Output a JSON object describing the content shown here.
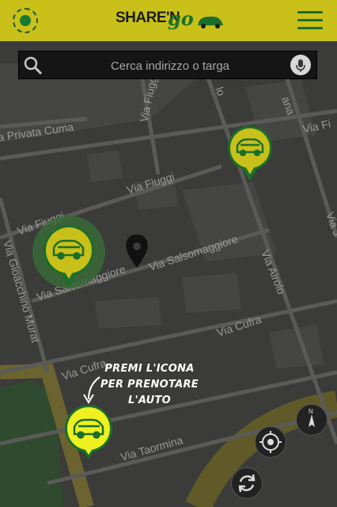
{
  "header": {
    "logo_prefix": "SHARE'N",
    "logo_suffix": "go",
    "status_icon": "status-indicator-icon",
    "menu_icon": "hamburger-menu-icon"
  },
  "search": {
    "placeholder": "Cerca indirizzo o targa",
    "search_icon": "magnifier-icon",
    "mic_icon": "microphone-icon"
  },
  "streets": {
    "privata_cuma": "a Privata Cuma",
    "fiuggi_1": "Via Fiuggi",
    "fiuggi_2": "Via Fiuggi",
    "fiuggi_vert": "Via Fiuggi",
    "salsomaggiore_1": "Via Salsomaggiore",
    "salsomaggiore_2": "Via Salsomaggiore",
    "gioacchino_murat": "Via Gioacchino Murat",
    "airolo": "Via Airolo",
    "cufra_1": "Via Cufra",
    "cufra_2": "Via Cufra",
    "taormina": "Via Taormina",
    "fi_right": "Via Fi",
    "j_right": "Via J",
    "ana": "ana",
    "lo": "lo"
  },
  "hint": {
    "line1": "PREMI L'ICONA",
    "line2": "PER PRENOTARE",
    "line3": "L'AUTO"
  },
  "colors": {
    "header_bg": "#c9c01a",
    "brand_green": "#1b6e2a",
    "marker_yellow": "#d6d21e",
    "highlight_marker": "#eef020"
  },
  "controls": {
    "compass_icon": "compass-north-icon",
    "locate_icon": "locate-crosshair-icon",
    "refresh_icon": "refresh-icon"
  }
}
